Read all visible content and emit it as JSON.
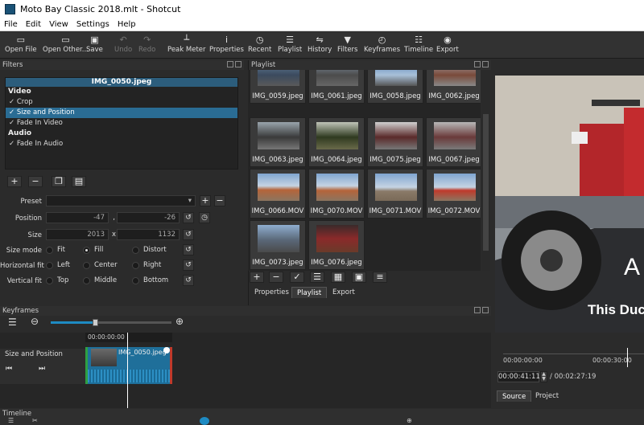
{
  "title": "Moto Bay Classic 2018.mlt - Shotcut",
  "menu": [
    "File",
    "Edit",
    "View",
    "Settings",
    "Help"
  ],
  "toolbar": {
    "open_file": "Open File",
    "open_other": "Open Other...",
    "save": "Save",
    "undo": "Undo",
    "redo": "Redo",
    "peak_meter": "Peak Meter",
    "properties": "Properties",
    "recent": "Recent",
    "playlist": "Playlist",
    "history": "History",
    "filters": "Filters",
    "keyframes": "Keyframes",
    "timeline": "Timeline",
    "export": "Export"
  },
  "filters_panel": {
    "title": "Filters",
    "clip_name": "IMG_0050.jpeg",
    "video_label": "Video",
    "video_filters": [
      "Crop",
      "Size and Position",
      "Fade In Video"
    ],
    "selected_filter_index": 1,
    "audio_label": "Audio",
    "audio_filters": [
      "Fade In Audio"
    ],
    "check": "✓",
    "preset_label": "Preset",
    "position_label": "Position",
    "position_x": "-47",
    "position_y": "-26",
    "comma": ",",
    "size_label": "Size",
    "size_w": "2013",
    "size_h": "1132",
    "x_sep": "x",
    "size_mode_label": "Size mode",
    "size_mode_options": [
      "Fit",
      "Fill",
      "Distort"
    ],
    "size_mode_selected": "Fill",
    "hfit_label": "Horizontal fit",
    "hfit_options": [
      "Left",
      "Center",
      "Right"
    ],
    "vfit_label": "Vertical fit",
    "vfit_options": [
      "Top",
      "Middle",
      "Bottom"
    ]
  },
  "playlist_panel": {
    "title": "Playlist",
    "items": [
      "IMG_0059.jpeg",
      "IMG_0061.jpeg",
      "IMG_0058.jpeg",
      "IMG_0062.jpeg",
      "IMG_0063.jpeg",
      "IMG_0064.jpeg",
      "IMG_0075.jpeg",
      "IMG_0067.jpeg",
      "IMG_0066.MOV",
      "IMG_0070.MOV",
      "IMG_0071.MOV",
      "IMG_0072.MOV",
      "IMG_0073.jpeg",
      "IMG_0076.jpeg"
    ],
    "tabs": [
      "Properties",
      "Playlist",
      "Export"
    ]
  },
  "viewer": {
    "overlay_char": "A",
    "overlay_text": "This Duc",
    "ruler_start": "00:00:00:00",
    "ruler_mid": "00:00:30:00",
    "current_time": "00:00:41:11",
    "total_time": "/ 00:02:27:19",
    "tabs": [
      "Source",
      "Project"
    ]
  },
  "keyframes_panel": {
    "title": "Keyframes",
    "timecode": "00:00:00:00",
    "track_label": "Size and Position",
    "clip_label": "IMG_0050.jpeg"
  },
  "timeline_panel": {
    "title": "Timeline"
  },
  "colors": {
    "selection": "#2a6c94",
    "accent_blue": "#1e8bc3",
    "clip_green": "#2ea043",
    "clip_red": "#c0392b"
  }
}
